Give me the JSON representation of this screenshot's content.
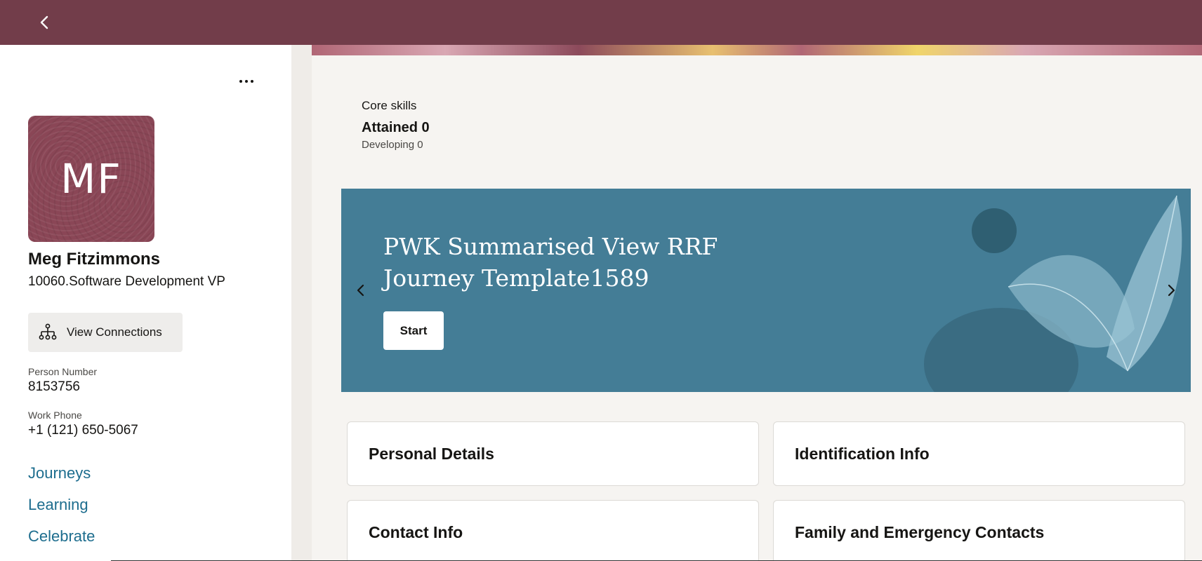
{
  "topbar": {
    "back_label": "Back",
    "back_icon": "chevron-left-icon",
    "color": "#723d4a"
  },
  "profile": {
    "more_icon": "ellipsis-icon",
    "initials": "MF",
    "name": "Meg Fitzimmons",
    "title": "10060.Software Development VP",
    "view_connections_label": "View Connections",
    "view_connections_icon": "org-chart-icon",
    "person_number_label": "Person Number",
    "person_number": "8153756",
    "work_phone_label": "Work Phone",
    "work_phone": "+1 (121) 650-5067",
    "nav": [
      {
        "label": "Journeys"
      },
      {
        "label": "Learning"
      },
      {
        "label": "Celebrate"
      }
    ]
  },
  "skills": {
    "heading": "Core skills",
    "attained": "Attained 0",
    "developing": "Developing 0"
  },
  "banner": {
    "title": "PWK Summarised View RRF Journey Template1589",
    "start_label": "Start",
    "prev_icon": "chevron-left-icon",
    "next_icon": "chevron-right-icon",
    "color": "#447d96"
  },
  "cards": [
    {
      "title": "Personal Details"
    },
    {
      "title": "Identification Info"
    },
    {
      "title": "Contact Info"
    },
    {
      "title": "Family and Emergency Contacts"
    }
  ],
  "colors": {
    "link": "#1d6d8e",
    "avatar": "#8a4656"
  }
}
